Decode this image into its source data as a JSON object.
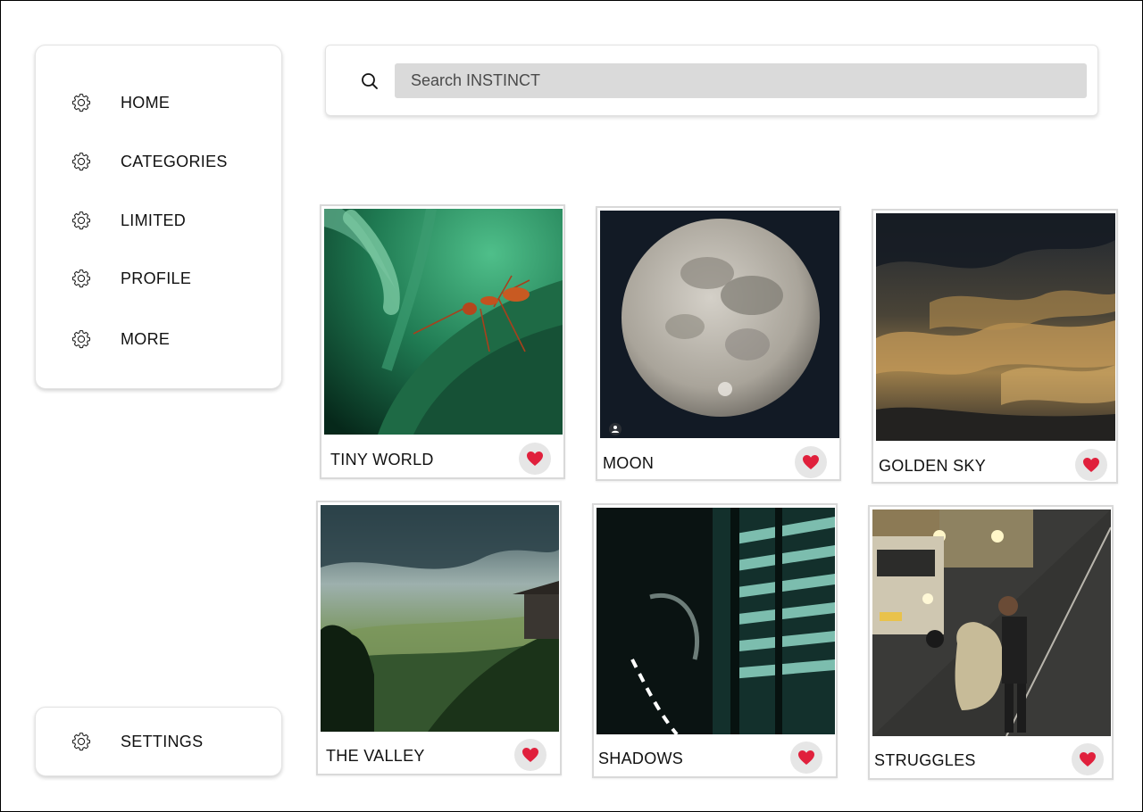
{
  "nav": {
    "items": [
      {
        "label": "HOME",
        "icon": "gear-icon"
      },
      {
        "label": "CATEGORIES",
        "icon": "gear-icon"
      },
      {
        "label": "LIMITED",
        "icon": "gear-icon"
      },
      {
        "label": "PROFILE",
        "icon": "gear-icon"
      },
      {
        "label": "MORE",
        "icon": "gear-icon"
      }
    ],
    "settings": {
      "label": "SETTINGS",
      "icon": "gear-icon"
    }
  },
  "search": {
    "placeholder": "Search INSTINCT",
    "value": "",
    "icon": "search-icon"
  },
  "colors": {
    "heart": "#e0203c",
    "like_bg": "#e6e6e6",
    "search_bg": "#dadada"
  },
  "photos": [
    {
      "title": "TINY WORLD",
      "subject": "ant on green leaf",
      "like_icon": "heart-icon"
    },
    {
      "title": "MOON",
      "subject": "full moon at night",
      "like_icon": "heart-icon"
    },
    {
      "title": "GOLDEN SKY",
      "subject": "golden clouds at dusk",
      "like_icon": "heart-icon"
    },
    {
      "title": "THE VALLEY",
      "subject": "misty green valley",
      "like_icon": "heart-icon"
    },
    {
      "title": "SHADOWS",
      "subject": "light through blinds",
      "like_icon": "heart-icon"
    },
    {
      "title": "STRUGGLES",
      "subject": "man carrying sack on road",
      "like_icon": "heart-icon"
    }
  ]
}
